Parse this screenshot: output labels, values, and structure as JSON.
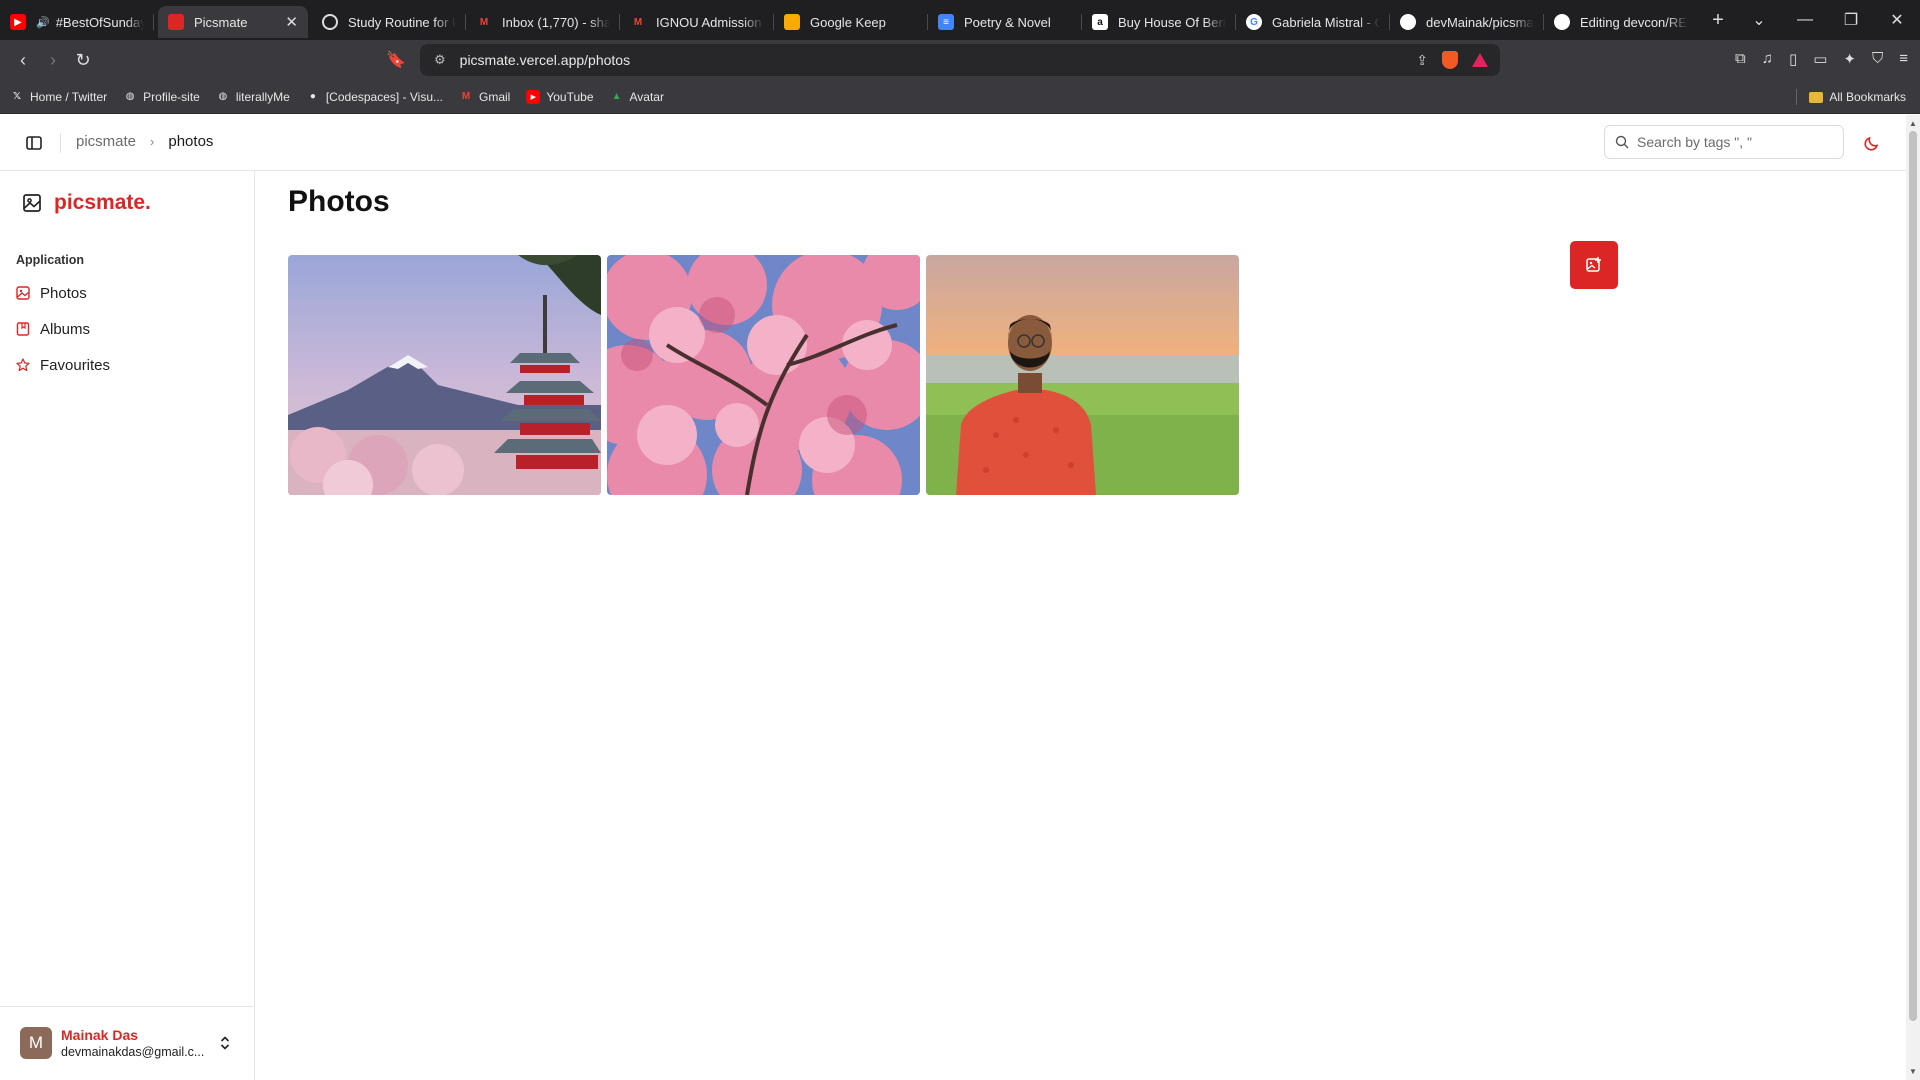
{
  "browser": {
    "tabs": [
      {
        "title": "#BestOfSunday",
        "favicon": "youtube-icon",
        "color": "#ff0000",
        "playing": true
      },
      {
        "title": "Picsmate",
        "favicon": "picsmate-icon",
        "color": "#dc2626",
        "active": true
      },
      {
        "title": "Study Routine for U",
        "favicon": "openai-icon",
        "color": "#e6e6e6"
      },
      {
        "title": "Inbox (1,770) - sha",
        "favicon": "gmail-icon",
        "color": "#ea4335"
      },
      {
        "title": "IGNOU Admission",
        "favicon": "gmail-icon",
        "color": "#ea4335"
      },
      {
        "title": "Google Keep",
        "favicon": "keep-icon",
        "color": "#f9ab00"
      },
      {
        "title": "Poetry & Novel",
        "favicon": "docs-icon",
        "color": "#4285f4"
      },
      {
        "title": "Buy House Of Bern",
        "favicon": "amazon-icon",
        "color": "#ffffff"
      },
      {
        "title": "Gabriela Mistral - G",
        "favicon": "google-icon",
        "color": "#ffffff"
      },
      {
        "title": "devMainak/picsma",
        "favicon": "github-icon",
        "color": "#ffffff"
      },
      {
        "title": "Editing devcon/REA",
        "favicon": "github-icon",
        "color": "#ffffff"
      }
    ],
    "url": "picsmate.vercel.app/photos",
    "bookmarks": [
      {
        "label": "Home / Twitter",
        "icon": "x-icon"
      },
      {
        "label": "Profile-site",
        "icon": "globe-icon"
      },
      {
        "label": "literallyMe",
        "icon": "globe-icon"
      },
      {
        "label": "[Codespaces] - Visu...",
        "icon": "github-icon"
      },
      {
        "label": "Gmail",
        "icon": "gmail-icon"
      },
      {
        "label": "YouTube",
        "icon": "youtube-icon"
      },
      {
        "label": "Avatar",
        "icon": "drive-icon"
      }
    ],
    "all_bookmarks": "All Bookmarks"
  },
  "app": {
    "breadcrumb": {
      "root": "picsmate",
      "current": "photos"
    },
    "search": {
      "placeholder": "Search by tags \", \""
    },
    "brand": "picsmate.",
    "group_label": "Application",
    "nav": [
      {
        "label": "Photos",
        "icon": "image-icon"
      },
      {
        "label": "Albums",
        "icon": "album-icon"
      },
      {
        "label": "Favourites",
        "icon": "star-icon"
      }
    ],
    "page_title": "Photos",
    "user": {
      "initial": "M",
      "name": "Mainak Das",
      "email": "devmainakdas@gmail.c..."
    },
    "accent": "#dc2626",
    "photos": [
      {
        "subject": "Mount Fuji with red pagoda and cherry blossoms"
      },
      {
        "subject": "Pink cherry blossom tree against blue sky"
      },
      {
        "subject": "Man in red shirt by a lake at sunset"
      }
    ]
  }
}
